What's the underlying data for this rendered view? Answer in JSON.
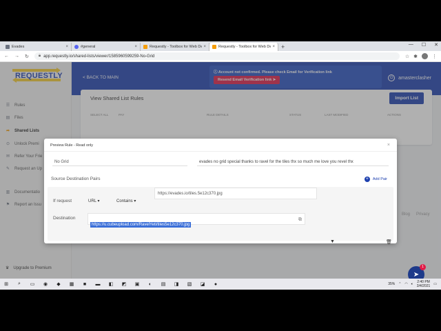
{
  "browser": {
    "tabs": [
      {
        "label": "Evades",
        "color": "#6b7280",
        "active": false
      },
      {
        "label": "#general",
        "color": "#5865f2",
        "active": false
      },
      {
        "label": "Requestly - Toolbox for Web Dev",
        "color": "#f59e0b",
        "active": false
      },
      {
        "label": "Requestly - Toolbox for Web Dev",
        "color": "#f59e0b",
        "active": true
      }
    ],
    "url": "app.requestly.io/shared-lists/viewer/1585960599259-No-Grid"
  },
  "app": {
    "logo": "REQUESTLY",
    "sidebar": {
      "items": [
        {
          "label": "Rules",
          "icon": "rules-icon",
          "active": false
        },
        {
          "label": "Files",
          "icon": "files-icon",
          "active": false
        },
        {
          "label": "Shared Lists",
          "icon": "share-icon",
          "active": true
        },
        {
          "label": "Unlock Premi",
          "icon": "unlock-icon",
          "active": false
        },
        {
          "label": "Refer Your Frie",
          "icon": "gift-icon",
          "active": false
        },
        {
          "label": "Request an Up",
          "icon": "request-icon",
          "active": false
        },
        {
          "label": "Documentatio",
          "icon": "docs-icon",
          "active": false
        },
        {
          "label": "Report an Issu",
          "icon": "bug-icon",
          "active": false
        }
      ],
      "upgrade": "Upgrade to Premium"
    },
    "header": {
      "back": "< BACK TO MAIN",
      "alert": "Account not confirmed. Please check Email for Verification link",
      "resend": "Resend Email Verification link",
      "username": "amasterclasher"
    },
    "card": {
      "title": "View Shared List Rules",
      "import": "Import List",
      "columns": [
        "SELECT ALL",
        "PAY",
        "RULE DETAILS",
        "STATUS",
        "LAST MODIFIED",
        "ACTIONS"
      ]
    },
    "footer_links": [
      "Blog",
      "Privacy"
    ]
  },
  "modal": {
    "title": "Preview Rule - Read only",
    "name": "No Grid",
    "description": "evades no grid special thanks to ravel for the tiles thx so much me love you revel thx",
    "section": "Source Destination Pairs",
    "add_pair": "Add Pair",
    "if_label": "If request",
    "source_type": "URL",
    "operator": "Contains",
    "source_value": "https://evades.io/tiles.5e12c370.jpg",
    "dest_label": "Destination",
    "dest_value": "https://u.cubeupload.com/RavelYeti/tiles5e12c370.jpg"
  },
  "chat_badge": "1",
  "taskbar": {
    "battery": "35%",
    "time": "2:40 PM",
    "date": "3/4/2021"
  }
}
